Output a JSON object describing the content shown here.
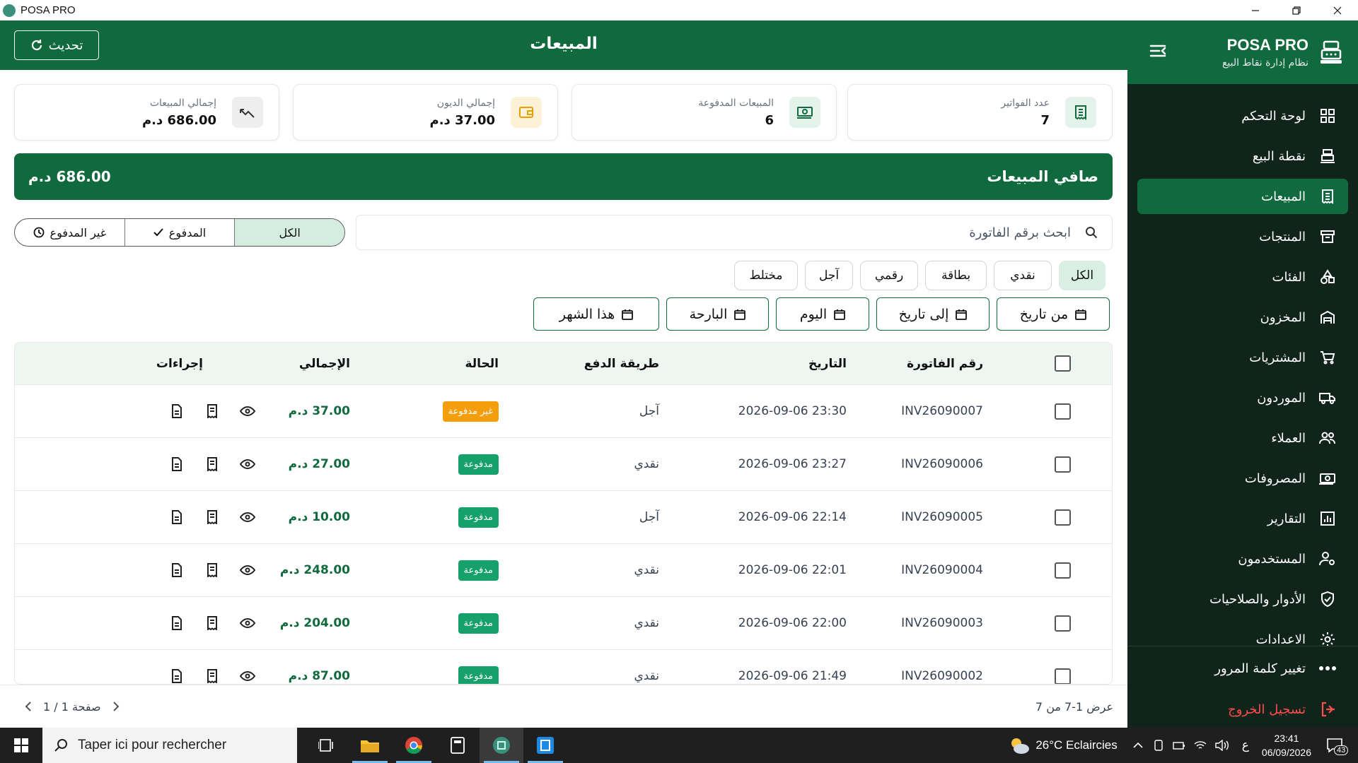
{
  "window": {
    "title": "POSA PRO"
  },
  "sidebar": {
    "brand": "POSA PRO",
    "subtitle": "نظام إدارة نقاط البيع",
    "items": [
      {
        "label": "لوحة التحكم",
        "icon": "dashboard-icon"
      },
      {
        "label": "نقطة البيع",
        "icon": "cash-register-icon"
      },
      {
        "label": "المبيعات",
        "icon": "receipt-icon",
        "active": true
      },
      {
        "label": "المنتجات",
        "icon": "archive-icon"
      },
      {
        "label": "الفئات",
        "icon": "shapes-icon"
      },
      {
        "label": "المخزون",
        "icon": "warehouse-icon"
      },
      {
        "label": "المشتريات",
        "icon": "cart-icon"
      },
      {
        "label": "الموردون",
        "icon": "truck-icon"
      },
      {
        "label": "العملاء",
        "icon": "users-icon"
      },
      {
        "label": "المصروفات",
        "icon": "money-icon"
      },
      {
        "label": "التقارير",
        "icon": "chart-icon"
      },
      {
        "label": "المستخدمون",
        "icon": "user-gear-icon"
      },
      {
        "label": "الأدوار والصلاحيات",
        "icon": "shield-icon"
      },
      {
        "label": "الاعدادات",
        "icon": "gear-icon"
      }
    ],
    "change_password": "تغيير كلمة المرور",
    "logout": "تسجيل الخروج"
  },
  "header": {
    "title": "المبيعات",
    "refresh": "تحديث"
  },
  "stats": [
    {
      "label": "عدد الفواتير",
      "value": "7",
      "icon": "receipt-icon",
      "color": "#116a3e",
      "bg": "#e3f2ea"
    },
    {
      "label": "المبيعات المدفوعة",
      "value": "6",
      "icon": "money-icon",
      "color": "#116a3e",
      "bg": "#e3f2ea"
    },
    {
      "label": "إجمالي الديون",
      "value": "37.00 د.م",
      "icon": "wallet-icon",
      "color": "#e6a100",
      "bg": "#fdf1d8"
    },
    {
      "label": "إجمالي المبيعات",
      "value": "686.00 د.م",
      "icon": "trend-icon",
      "color": "#333333",
      "bg": "#eeeeee"
    }
  ],
  "net": {
    "label": "صافي المبيعات",
    "value": "686.00 د.م"
  },
  "search": {
    "placeholder": "ابحث برقم الفاتورة"
  },
  "status_filter": [
    "الكل",
    "المدفوع",
    "غير المدفوع"
  ],
  "method_filter": [
    "الكل",
    "نقدي",
    "بطاقة",
    "رقمي",
    "آجل",
    "مختلط"
  ],
  "date_buttons": [
    "من تاريخ",
    "إلى تاريخ",
    "اليوم",
    "البارحة",
    "هذا الشهر"
  ],
  "table": {
    "columns": [
      "رقم الفاتورة",
      "التاريخ",
      "طريقة الدفع",
      "الحالة",
      "الإجمالي",
      "إجراءات"
    ],
    "rows": [
      {
        "invoice": "INV26090007",
        "date": "2026-09-06 23:30",
        "method": "آجل",
        "status": "غير مدفوعة",
        "paid": false,
        "total": "37.00 د.م"
      },
      {
        "invoice": "INV26090006",
        "date": "2026-09-06 23:27",
        "method": "نقدي",
        "status": "مدفوعة",
        "paid": true,
        "total": "27.00 د.م"
      },
      {
        "invoice": "INV26090005",
        "date": "2026-09-06 22:14",
        "method": "آجل",
        "status": "مدفوعة",
        "paid": true,
        "total": "10.00 د.م"
      },
      {
        "invoice": "INV26090004",
        "date": "2026-09-06 22:01",
        "method": "نقدي",
        "status": "مدفوعة",
        "paid": true,
        "total": "248.00 د.م"
      },
      {
        "invoice": "INV26090003",
        "date": "2026-09-06 22:00",
        "method": "نقدي",
        "status": "مدفوعة",
        "paid": true,
        "total": "204.00 د.م"
      },
      {
        "invoice": "INV26090002",
        "date": "2026-09-06 21:49",
        "method": "نقدي",
        "status": "مدفوعة",
        "paid": true,
        "total": "87.00 د.م"
      }
    ]
  },
  "footer": {
    "showing": "عرض 1-7 من 7",
    "page": "صفحة 1 / 1"
  },
  "taskbar": {
    "search_placeholder": "Taper ici pour rechercher",
    "weather": "26°C  Eclaircies",
    "time": "23:41",
    "date": "06/09/2026",
    "notifications": "43",
    "lang": "ع"
  },
  "colors": {
    "primary": "#116a3e",
    "sidebar_bg": "#10241b",
    "unpaid": "#f59e0b",
    "paid": "#16a06a",
    "logout": "#ff4d4d"
  }
}
